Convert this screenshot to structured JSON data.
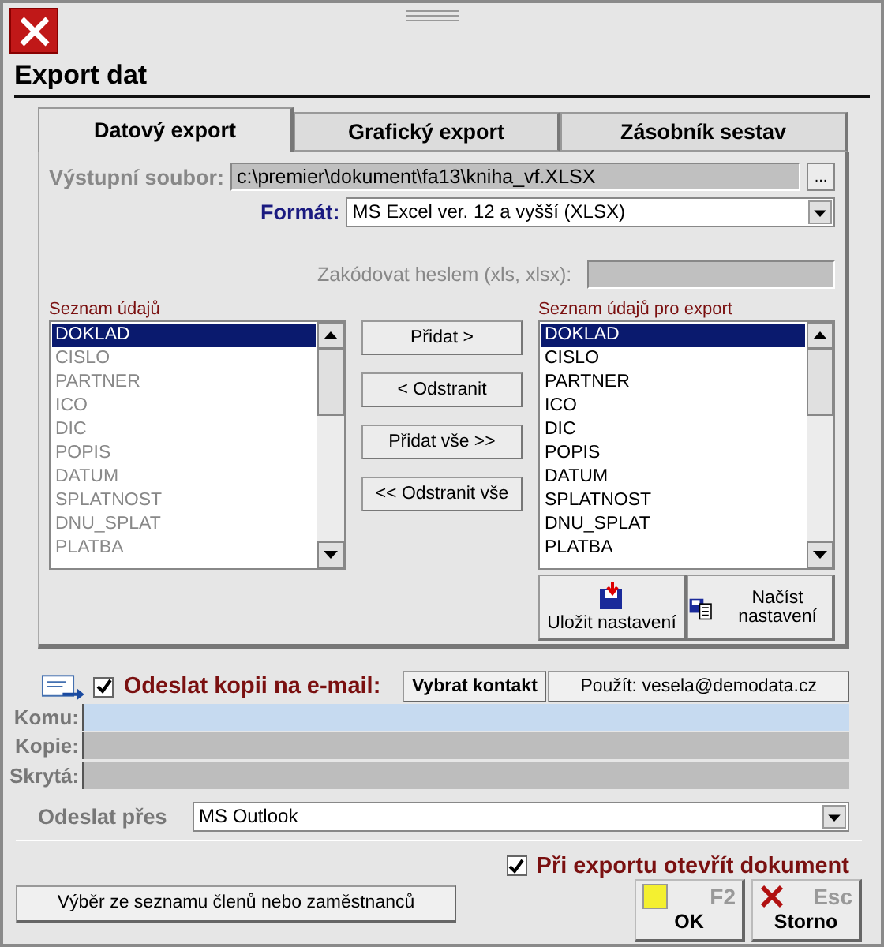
{
  "title": "Export dat",
  "tabs": [
    {
      "label": "Datový export",
      "selected": true
    },
    {
      "label": "Grafický export",
      "selected": false
    },
    {
      "label": "Zásobník sestav",
      "selected": false
    }
  ],
  "output_file": {
    "label": "Výstupní soubor:",
    "value": "c:\\premier\\dokument\\fa13\\kniha_vf.XLSX",
    "browse": "...",
    "disabled": true
  },
  "format": {
    "label": "Formát:",
    "value": "MS Excel ver. 12 a vyšší (XLSX)"
  },
  "password": {
    "label": "Zakódovat heslem (xls, xlsx):",
    "disabled": true
  },
  "available": {
    "label": "Seznam údajů",
    "disabled": true,
    "items": [
      {
        "text": "DOKLAD",
        "selected": true
      },
      {
        "text": "CISLO",
        "selected": false
      },
      {
        "text": "PARTNER",
        "selected": false
      },
      {
        "text": "ICO",
        "selected": false
      },
      {
        "text": "DIC",
        "selected": false
      },
      {
        "text": "POPIS",
        "selected": false
      },
      {
        "text": "DATUM",
        "selected": false
      },
      {
        "text": "SPLATNOST",
        "selected": false
      },
      {
        "text": "DNU_SPLAT",
        "selected": false
      },
      {
        "text": "PLATBA",
        "selected": false
      }
    ]
  },
  "move_buttons": [
    "Přidat >",
    "< Odstranit",
    "Přidat vše >>",
    "<< Odstranit vše"
  ],
  "export": {
    "label": "Seznam údajů pro export",
    "disabled": false,
    "items": [
      {
        "text": "DOKLAD",
        "selected": true
      },
      {
        "text": "CISLO",
        "selected": false
      },
      {
        "text": "PARTNER",
        "selected": false
      },
      {
        "text": "ICO",
        "selected": false
      },
      {
        "text": "DIC",
        "selected": false
      },
      {
        "text": "POPIS",
        "selected": false
      },
      {
        "text": "DATUM",
        "selected": false
      },
      {
        "text": "SPLATNOST",
        "selected": false
      },
      {
        "text": "DNU_SPLAT",
        "selected": false
      },
      {
        "text": "PLATBA",
        "selected": false
      }
    ]
  },
  "save_settings": "Uložit nastavení",
  "load_settings": "Načíst nastavení",
  "email": {
    "checked": true,
    "label": "Odeslat kopii na e-mail:",
    "pick_contact": "Vybrat kontakt",
    "use_address": "Použít: vesela@demodata.cz",
    "fields": [
      {
        "label": "Komu:",
        "active": true
      },
      {
        "label": "Kopie:",
        "active": false
      },
      {
        "label": "Skrytá:",
        "active": false
      }
    ]
  },
  "send_via": {
    "label": "Odeslat přes",
    "value": "MS Outlook"
  },
  "open_after": {
    "checked": true,
    "label": "Při exportu otevřít dokument"
  },
  "pick_members": "Výběr ze seznamu členů nebo zaměstnanců",
  "ok": {
    "key": "F2",
    "label": "OK"
  },
  "cancel": {
    "key": "Esc",
    "label": "Storno"
  }
}
